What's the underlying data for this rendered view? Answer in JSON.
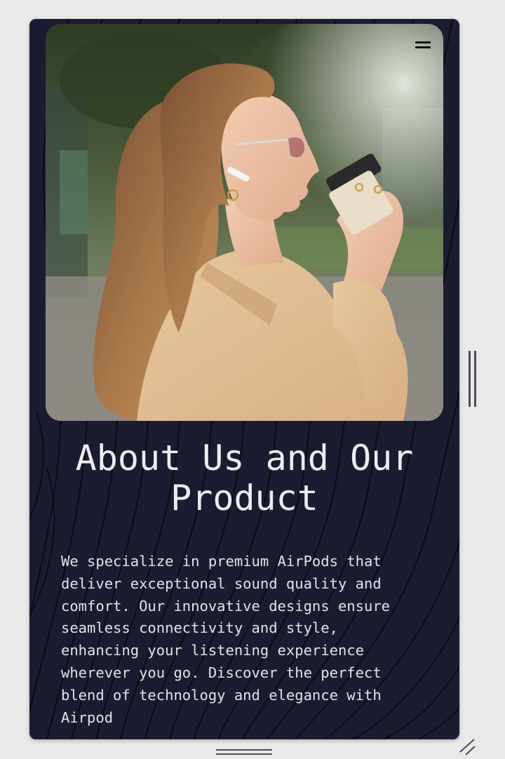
{
  "section": {
    "heading_line1": "About Us and Our",
    "heading_line2": "Product",
    "paragraph": "We specialize in premium AirPods that deliver exceptional sound quality and comfort. Our innovative designs ensure seamless connectivity and style, enhancing your listening experience wherever you go. Discover the perfect blend of technology and elegance with Airpod"
  },
  "icons": {
    "menu": "hamburger-menu-icon",
    "scrollbar": "vertical-scroll-handle",
    "bottom_handle": "horizontal-drag-handle",
    "resize": "resize-grip-icon"
  },
  "colors": {
    "page_background": "#e9e9ea",
    "card_background": "#1b1c31",
    "heading_text": "#ededee",
    "body_text": "#e3e3e6",
    "pattern_lines": "#0b0c16"
  }
}
